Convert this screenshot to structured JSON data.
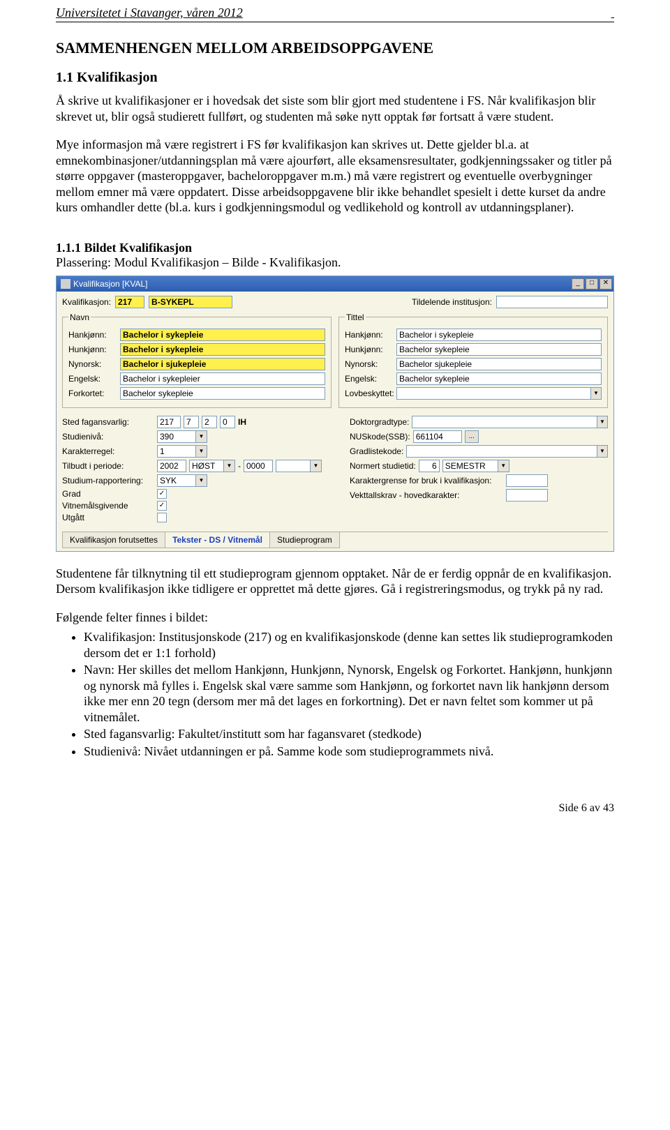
{
  "header": {
    "left": "Universitetet i Stavanger, våren 2012"
  },
  "h1": "SAMMENHENGEN MELLOM ARBEIDSOPPGAVENE",
  "h2": "1.1 Kvalifikasjon",
  "para1": "Å skrive ut kvalifikasjoner er i hovedsak det siste som blir gjort med studentene i FS. Når kvalifikasjon blir skrevet ut, blir også studierett fullført, og studenten må søke nytt opptak før fortsatt å være student.",
  "para2": "Mye informasjon må være registrert i FS før kvalifikasjon kan skrives ut. Dette gjelder bl.a. at emnekombinasjoner/utdanningsplan må være ajourført, alle eksamensresultater, godkjenningssaker og titler på større oppgaver (masteroppgaver, bacheloroppgaver m.m.) må være registrert og eventuelle overbygninger mellom emner må være oppdatert. Disse arbeidsoppgavene blir ikke behandlet spesielt i dette kurset da andre kurs omhandler dette (bl.a. kurs i godkjenningsmodul og vedlikehold og kontroll av utdanningsplaner).",
  "section_title": "1.1.1 Bildet Kvalifikasjon",
  "section_sub": "Plassering: Modul Kvalifikasjon – Bilde - Kvalifikasjon.",
  "app": {
    "title": "Kvalifikasjon [KVAL]",
    "kvalifikasjon_label": "Kvalifikasjon:",
    "kvalifikasjon_code": "217",
    "kvalifikasjon_name": "B-SYKEPL",
    "tildelende_label": "Tildelende institusjon:",
    "navn_legend": "Navn",
    "tittel_legend": "Tittel",
    "rows_labels": {
      "hankjonn": "Hankjønn:",
      "hunkjonn": "Hunkjønn:",
      "nynorsk": "Nynorsk:",
      "engelsk": "Engelsk:",
      "forkortet": "Forkortet:",
      "lovbeskyttet": "Lovbeskyttet:"
    },
    "navn": {
      "hankjonn": "Bachelor i sykepleie",
      "hunkjonn": "Bachelor i sykepleie",
      "nynorsk": "Bachelor i sjukepleie",
      "engelsk": "Bachelor i sykepleier",
      "forkortet": "Bachelor sykepleie"
    },
    "tittel": {
      "hankjonn": "Bachelor i sykepleie",
      "hunkjonn": "Bachelor sykepleie",
      "nynorsk": "Bachelor sjukepleie",
      "engelsk": "Bachelor sykepleie",
      "lovbeskyttet": ""
    },
    "left": {
      "sted_label": "Sted fagansvarlig:",
      "sted_vals": [
        "217",
        "7",
        "2",
        "0",
        "IH"
      ],
      "studieniva_label": "Studienivå:",
      "studieniva": "390",
      "karakterregel_label": "Karakterregel:",
      "karakterregel": "1",
      "tilbudt_label": "Tilbudt i periode:",
      "tilbudt_year": "2002",
      "tilbudt_sem": "HØST",
      "tilbudt_dash": "-",
      "tilbudt_year2": "0000",
      "studrap_label": "Studium-rapportering:",
      "studrap": "SYK",
      "grad_label": "Grad",
      "vitnemal_label": "Vitnemålsgivende",
      "utgatt_label": "Utgått"
    },
    "right": {
      "doktorgrad_label": "Doktorgradtype:",
      "nuskode_label": "NUSkode(SSB):",
      "nuskode": "661104",
      "nuskode_btn": "...",
      "gradliste_label": "Gradlistekode:",
      "normert_label": "Normert studietid:",
      "normert_n": "6",
      "normert_u": "SEMESTR",
      "kargrense_label": "Karaktergrense for bruk i kvalifikasjon:",
      "vekttall_label": "Vekttallskrav - hovedkarakter:"
    },
    "tabs": [
      "Kvalifikasjon forutsettes",
      "Tekster - DS / Vitnemål",
      "Studieprogram"
    ]
  },
  "para3": "Studentene får tilknytning til ett studieprogram gjennom opptaket. Når de er ferdig oppnår de en kvalifikasjon. Dersom kvalifikasjon ikke tidligere er opprettet må dette gjøres. Gå i registreringsmodus, og trykk på ny rad.",
  "bul_intro": "Følgende felter finnes i bildet:",
  "bullets": [
    "Kvalifikasjon: Institusjonskode (217) og en kvalifikasjonskode (denne kan settes lik studieprogramkoden dersom det er 1:1 forhold)",
    "Navn: Her skilles det mellom Hankjønn, Hunkjønn, Nynorsk, Engelsk og Forkortet. Hankjønn, hunkjønn og nynorsk må fylles i. Engelsk skal være samme som Hankjønn, og forkortet navn lik hankjønn dersom ikke mer enn 20 tegn (dersom mer må det lages en forkortning). Det er navn feltet som kommer ut på vitnemålet.",
    "Sted fagansvarlig: Fakultet/institutt som har fagansvaret (stedkode)",
    "Studienivå: Nivået utdanningen er på. Samme kode som studieprogrammets nivå."
  ],
  "footer": "Side 6 av 43"
}
